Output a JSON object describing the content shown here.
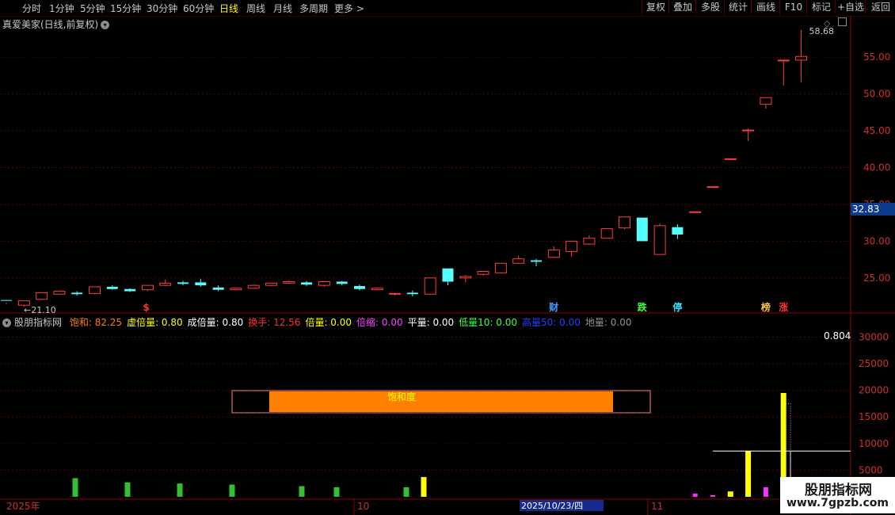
{
  "toolbar": {
    "timeframes": [
      "分时",
      "1分钟",
      "5分钟",
      "15分钟",
      "30分钟",
      "60分钟",
      "日线",
      "周线",
      "月线",
      "多周期",
      "更多"
    ],
    "active_timeframe": "日线",
    "buttons": [
      "复权",
      "叠加",
      "多股",
      "统计",
      "画线",
      "F10",
      "标记",
      "+自选",
      "返回"
    ]
  },
  "stock": {
    "title": "真爱美家(日线,前复权)"
  },
  "price_axis": {
    "ticks": [
      "55.00",
      "50.00",
      "45.00",
      "40.00",
      "35.00",
      "30.00",
      "25.00"
    ],
    "last_price": "32.83"
  },
  "price_annotations": {
    "high": "58.68",
    "low": "21.10"
  },
  "event_markers": [
    {
      "label": "$",
      "color": "#ff3030"
    },
    {
      "label": "财",
      "color": "#40a0ff"
    },
    {
      "label": "跌",
      "color": "#40ff40"
    },
    {
      "label": "停",
      "color": "#40e0ff"
    },
    {
      "label": "榜",
      "color": "#ffc040"
    },
    {
      "label": "涨",
      "color": "#ff3030"
    }
  ],
  "indicator": {
    "name": "股朋指标网",
    "items": [
      {
        "label": "饱和: 82.25",
        "color": "#ff8000"
      },
      {
        "label": "虚倍量: 0.80",
        "color": "#ffff00"
      },
      {
        "label": "成倍量: 0.80",
        "color": "#ffffff"
      },
      {
        "label": "换手: 12.56",
        "color": "#ff3030"
      },
      {
        "label": "倍量: 0.00",
        "color": "#ffff00"
      },
      {
        "label": "倍缩: 0.00",
        "color": "#ff40ff"
      },
      {
        "label": "平量: 0.00",
        "color": "#ffffff"
      },
      {
        "label": "低量10: 0.00",
        "color": "#40ff40"
      },
      {
        "label": "高量50: 0.00",
        "color": "#2040ff"
      },
      {
        "label": "地量: 0.00",
        "color": "#909090"
      }
    ],
    "saturation_label": "饱和度",
    "saturation_value": 0.8225,
    "value_label": "0.804",
    "axis_ticks": [
      "30000",
      "25000",
      "20000",
      "15000",
      "10000",
      "5000"
    ]
  },
  "date_axis": {
    "labels": [
      "2025年",
      "10",
      "2025/10/23/四",
      "11"
    ]
  },
  "watermark": {
    "line1": "股朋指标网",
    "line2": "www.7gpzb.com"
  },
  "colors": {
    "up": "#ff3c3c",
    "down": "#54ffff",
    "grid": "#5a0000",
    "accent": "#ff8000"
  },
  "chart_data": {
    "type": "candlestick",
    "candles": [
      [
        21.9,
        22.0,
        21.6,
        21.5,
        "d"
      ],
      [
        21.3,
        21.9,
        21.9,
        21.1,
        "u"
      ],
      [
        22.1,
        23.0,
        23.0,
        22.0,
        "u"
      ],
      [
        22.8,
        23.2,
        23.2,
        22.7,
        "u"
      ],
      [
        23.0,
        22.8,
        23.2,
        22.6,
        "d"
      ],
      [
        22.9,
        23.8,
        23.8,
        22.8,
        "u"
      ],
      [
        23.8,
        23.5,
        24.0,
        23.4,
        "d"
      ],
      [
        23.5,
        23.2,
        23.6,
        23.1,
        "d"
      ],
      [
        23.4,
        24.0,
        24.0,
        23.2,
        "u"
      ],
      [
        24.0,
        24.3,
        24.8,
        23.9,
        "u"
      ],
      [
        24.4,
        24.2,
        24.6,
        24.0,
        "d"
      ],
      [
        24.4,
        24.0,
        24.9,
        23.8,
        "d"
      ],
      [
        23.7,
        23.4,
        24.0,
        23.2,
        "d"
      ],
      [
        23.4,
        23.6,
        23.7,
        23.3,
        "u"
      ],
      [
        23.6,
        24.0,
        24.1,
        23.5,
        "u"
      ],
      [
        24.0,
        24.3,
        24.3,
        23.9,
        "u"
      ],
      [
        24.3,
        24.5,
        24.7,
        24.2,
        "u"
      ],
      [
        24.4,
        24.1,
        24.6,
        23.9,
        "d"
      ],
      [
        24.0,
        24.5,
        24.6,
        23.8,
        "u"
      ],
      [
        24.5,
        24.2,
        24.6,
        24.0,
        "d"
      ],
      [
        23.9,
        23.5,
        24.1,
        23.3,
        "d"
      ],
      [
        23.4,
        23.6,
        23.7,
        23.3,
        "u"
      ],
      [
        22.8,
        22.9,
        23.0,
        22.6,
        "u"
      ],
      [
        23.0,
        22.8,
        23.3,
        22.5,
        "d"
      ],
      [
        22.8,
        25.0,
        25.0,
        22.7,
        "u"
      ],
      [
        26.3,
        24.5,
        26.3,
        24.0,
        "d"
      ],
      [
        25.0,
        25.2,
        25.4,
        24.4,
        "u"
      ],
      [
        25.5,
        25.9,
        25.9,
        25.3,
        "u"
      ],
      [
        25.7,
        27.0,
        27.0,
        25.6,
        "u"
      ],
      [
        27.0,
        27.6,
        28.0,
        26.9,
        "u"
      ],
      [
        27.4,
        27.2,
        27.6,
        26.6,
        "d"
      ],
      [
        27.8,
        28.8,
        29.3,
        27.7,
        "u"
      ],
      [
        28.6,
        30.0,
        30.0,
        27.9,
        "u"
      ],
      [
        29.6,
        30.4,
        30.8,
        29.5,
        "u"
      ],
      [
        30.4,
        31.7,
        31.7,
        30.4,
        "u"
      ],
      [
        31.8,
        33.3,
        33.3,
        31.6,
        "u"
      ],
      [
        33.2,
        30.0,
        33.2,
        30.0,
        "d"
      ],
      [
        28.2,
        32.1,
        32.4,
        28.2,
        "u"
      ],
      [
        31.9,
        30.9,
        32.3,
        30.3,
        "d"
      ],
      [
        34.0,
        34.0,
        34.0,
        34.0,
        "u"
      ],
      [
        37.4,
        37.4,
        37.4,
        37.4,
        "u"
      ],
      [
        41.2,
        41.2,
        41.2,
        41.2,
        "u"
      ],
      [
        45.0,
        45.1,
        45.3,
        43.6,
        "u"
      ],
      [
        48.6,
        49.5,
        49.5,
        48.0,
        "u"
      ],
      [
        54.6,
        54.6,
        54.6,
        51.1,
        "u"
      ],
      [
        54.6,
        55.1,
        58.7,
        51.6,
        "u"
      ]
    ],
    "volumes": [
      {
        "i": 4,
        "v": 3500,
        "c": "green"
      },
      {
        "i": 7,
        "v": 2700,
        "c": "green"
      },
      {
        "i": 10,
        "v": 2500,
        "c": "green"
      },
      {
        "i": 13,
        "v": 2300,
        "c": "green"
      },
      {
        "i": 17,
        "v": 1500,
        "c": "magenta"
      },
      {
        "i": 17,
        "v": 2000,
        "c": "green"
      },
      {
        "i": 19,
        "v": 1800,
        "c": "green"
      },
      {
        "i": 23,
        "v": 1800,
        "c": "green"
      },
      {
        "i": 24,
        "v": 3700,
        "c": "yellow"
      },
      {
        "i": 39,
        "v": 600,
        "c": "magenta"
      },
      {
        "i": 40,
        "v": 300,
        "c": "magenta"
      },
      {
        "i": 41,
        "v": 1000,
        "c": "yellow"
      },
      {
        "i": 42,
        "v": 8600,
        "c": "yellow"
      },
      {
        "i": 43,
        "v": 1800,
        "c": "magenta"
      },
      {
        "i": 44,
        "v": 19500,
        "c": "yellow"
      }
    ],
    "ylim_price": [
      21.0,
      59.0
    ],
    "ylim_volume": [
      0,
      32000
    ],
    "volume_reference_line": 8600
  }
}
